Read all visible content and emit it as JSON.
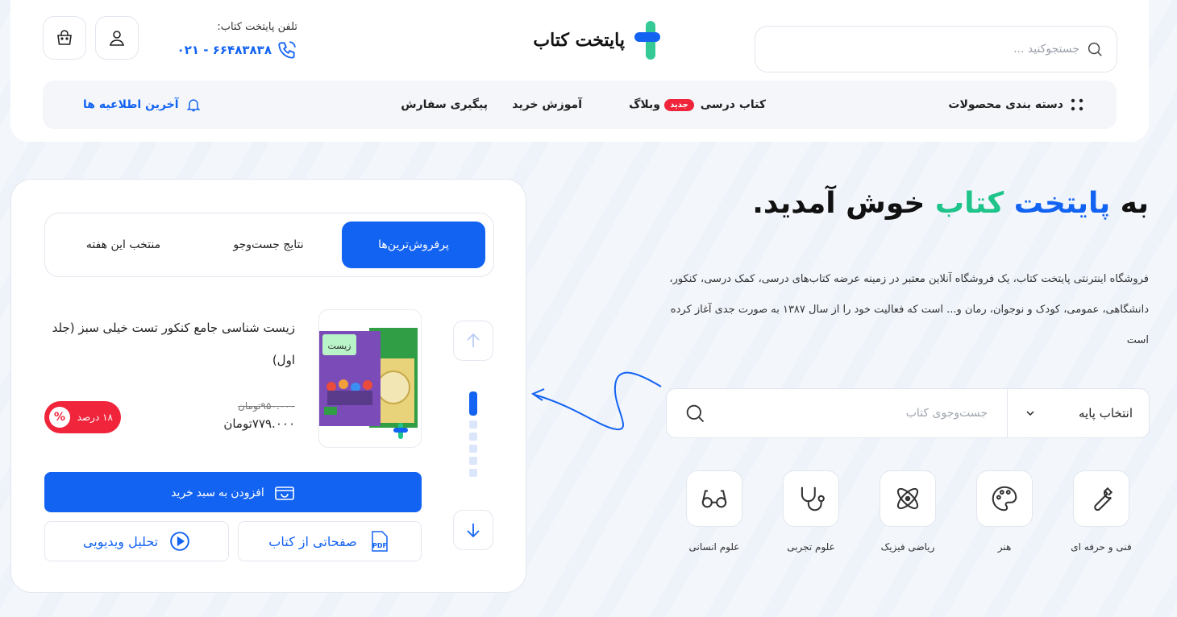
{
  "header": {
    "search_placeholder": "جستجوکنید ...",
    "logo_text": "پایتخت کتاب",
    "phone_label": "تلفن پایتخت کتاب:",
    "phone_number": "۰۲۱ - ۶۶۴۸۳۸۳۸",
    "nav": {
      "categories_label": "دسته بندی محصولات",
      "items": [
        {
          "label": "کتاب درسی",
          "badge": "جدید"
        },
        {
          "label": "وبلاگ"
        },
        {
          "label": "آموزش خرید"
        },
        {
          "label": "پیگیری سفارش"
        }
      ],
      "announcements_label": "آخرین اطلاعیه ها"
    }
  },
  "hero": {
    "title_prefix": "به",
    "title_brand_1": "پایتخت",
    "title_brand_2": "کتاب",
    "title_suffix": "خوش آمدید.",
    "description": "فروشگاه اینترنتی پایتخت کتاب، یک فروشگاه آنلاین معتبر در زمینه عرضه کتاب‌های درسی، کمک درسی، کنکور، دانشگاهی، عمومی، کودک و نوجوان، رمان و... است که فعالیت خود را از سال ۱۳۸۷ به صورت جدی آغاز کرده است",
    "grade_select_label": "انتخاب پایه",
    "book_search_placeholder": "جست‌وجوی کتاب",
    "categories": [
      {
        "label": "فنی و حرفه ای",
        "icon": "wrench-icon"
      },
      {
        "label": "هنر",
        "icon": "palette-icon"
      },
      {
        "label": "ریاضی فیزیک",
        "icon": "atom-icon"
      },
      {
        "label": "علوم تجربی",
        "icon": "stethoscope-icon"
      },
      {
        "label": "علوم انسانی",
        "icon": "glasses-icon"
      }
    ]
  },
  "product_card": {
    "tabs": [
      {
        "label": "پرفروش‌ترین‌ها",
        "active": true
      },
      {
        "label": "نتایج جست‌وجو",
        "active": false
      },
      {
        "label": "منتخب این هفته",
        "active": false
      }
    ],
    "product": {
      "title": "زیست شناسی جامع کنکور تست خیلی سبز (جلد اول)",
      "old_price": "۹۵۰.۰۰۰تومان",
      "new_price": "۷۷۹.۰۰۰تومان",
      "discount_label": "۱۸ درصد",
      "discount_symbol": "%",
      "cover_text": "زیست"
    },
    "add_to_cart_label": "افزودن به سبد خرید",
    "pdf_button_label": "صفحاتی از کتاب",
    "pdf_icon_text": "PDF",
    "video_button_label": "تحلیل ویدیویی",
    "slider_active_index": 0,
    "slider_count": 6
  },
  "colors": {
    "primary": "#1363f2",
    "accent_green": "#1fc48a",
    "danger": "#f0243b"
  }
}
